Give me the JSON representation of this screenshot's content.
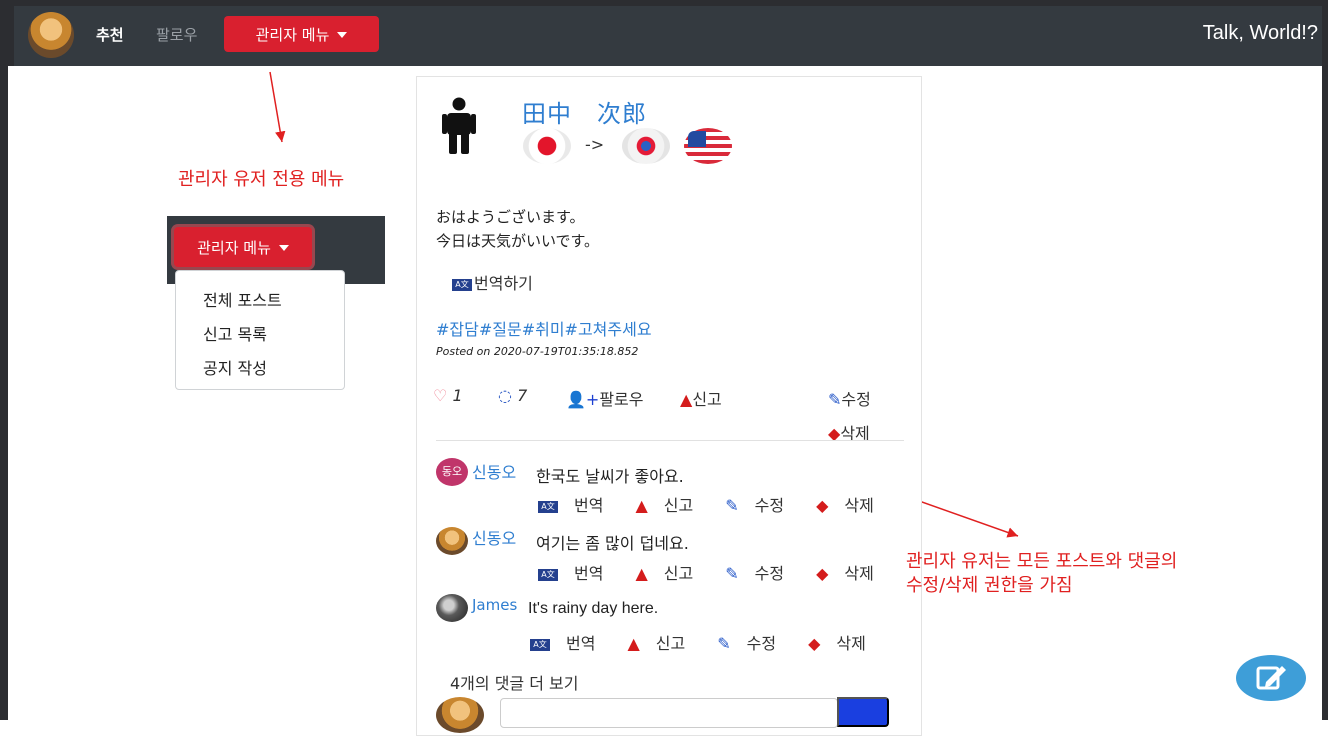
{
  "navbar": {
    "recommend": "추천",
    "follow": "팔로우",
    "admin_menu": "관리자 메뉴",
    "brand": "Talk, World!?"
  },
  "annotations": {
    "admin_menu_caption": "관리자 유저 전용 메뉴",
    "permission_line1": "관리자 유저는 모든 포스트와 댓글의",
    "permission_line2": "수정/삭제 권한을 가짐"
  },
  "dropdown": {
    "button": "관리자 메뉴",
    "items": [
      "전체 포스트",
      "신고 목록",
      "공지 작성"
    ]
  },
  "post": {
    "author": "田中　次郎",
    "lang_arrow": "->",
    "line1": "おはようございます。",
    "line2": "今日は天気がいいです。",
    "translate": "번역하기",
    "tags": "#잡담#질문#취미#고쳐주세요",
    "posted": "Posted on 2020-07-19T01:35:18.852",
    "likes": "1",
    "comments": "7",
    "follow": "팔로우",
    "report": "신고",
    "edit": "수정",
    "delete": "삭제"
  },
  "comments": [
    {
      "avatar_text": "동오",
      "author": "신동오",
      "text": "한국도 날씨가 좋아요."
    },
    {
      "author": "신동오",
      "text": "여기는 좀 많이 덥네요."
    },
    {
      "author": "James",
      "text": "It's rainy day here."
    }
  ],
  "comment_actions": {
    "translate": "번역",
    "report": "신고",
    "edit": "수정",
    "delete": "삭제"
  },
  "more_comments": "4개의 댓글 더 보기",
  "icons": {
    "translate": "translate-icon",
    "heart": "heart-icon",
    "comment": "comment-icon",
    "follow": "user-plus-icon",
    "report": "warning-icon",
    "edit": "pencil-icon",
    "delete": "eraser-icon",
    "fab": "compose-icon"
  },
  "colors": {
    "navbar": "#343a40",
    "admin_button": "#d9202f",
    "link": "#2f7ed0",
    "annotation": "#e02020",
    "fab": "#3e9ed8"
  }
}
